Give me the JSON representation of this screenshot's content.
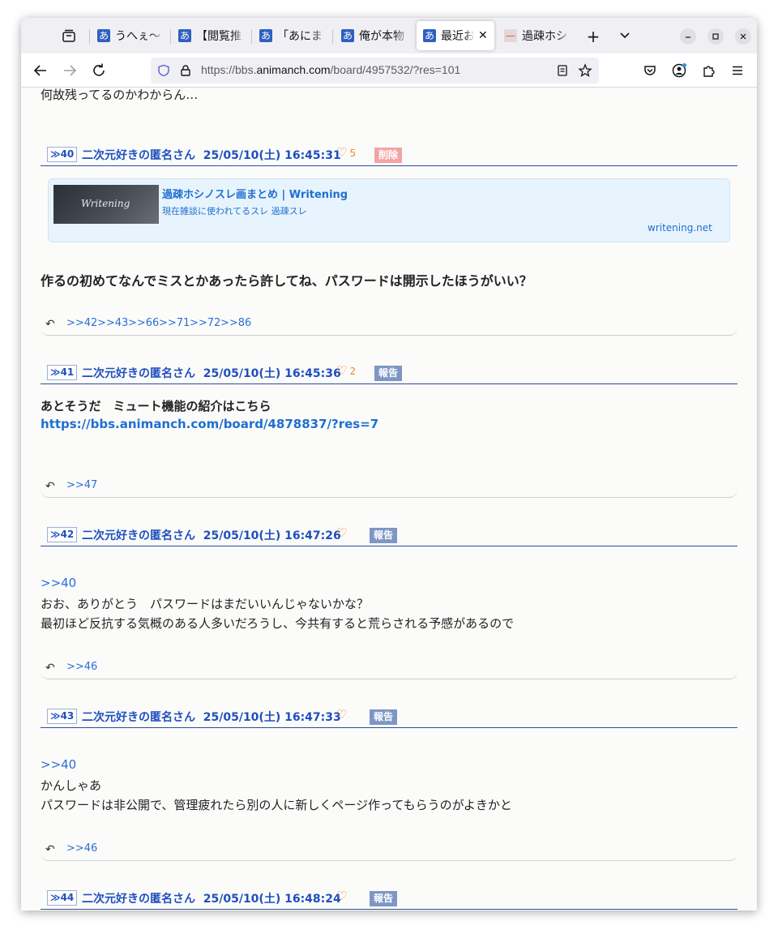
{
  "browser": {
    "tabs": [
      {
        "favicon": "あ",
        "title": "うへぇ〜"
      },
      {
        "favicon": "あ",
        "title": "【閲覧推"
      },
      {
        "favicon": "あ",
        "title": "「あにま"
      },
      {
        "favicon": "あ",
        "title": "俺が本物"
      },
      {
        "favicon": "あ",
        "title": "最近お"
      },
      {
        "favicon": "—",
        "title": "過疎ホシ"
      }
    ],
    "close_glyph": "✕",
    "new_tab_glyph": "+",
    "list_glyph": "⌄",
    "url_prefix": "https://bbs.",
    "url_host": "animanch.com",
    "url_path": "/board/4957532/?res=101"
  },
  "page": {
    "top_text": "何故残ってるのかわからん…",
    "posts": [
      {
        "num": "≫40",
        "name": "二次元好きの匿名さん",
        "date": "25/05/10(土) 16:45:31",
        "likes": "5",
        "badge": "削除",
        "card": {
          "thumb_text": "Writening",
          "title": "過疎ホシノスレ画まとめ | Writening",
          "desc": "現在雑談に使われてるスレ 過疎スレ",
          "domain": "writening.net"
        },
        "body": [
          "作るの初めてなんでミスとかあったら許してね、パスワードは開示したほうがいい？"
        ],
        "replies": [
          ">>42",
          ">>43",
          ">>66",
          ">>71",
          ">>72",
          ">>86"
        ]
      },
      {
        "num": "≫41",
        "name": "二次元好きの匿名さん",
        "date": "25/05/10(土) 16:45:36",
        "likes": "2",
        "badge": "報告",
        "body": [
          "あとそうだ　ミュート機能の紹介はこちら"
        ],
        "link": "https://bbs.animanch.com/board/4878837/?res=7",
        "replies": [
          ">>47"
        ]
      },
      {
        "num": "≫42",
        "name": "二次元好きの匿名さん",
        "date": "25/05/10(土) 16:47:26",
        "likes": "",
        "badge": "報告",
        "anchor": ">>40",
        "body": [
          "おお、ありがとう　パスワードはまだいいんじゃないかな？",
          "最初ほど反抗する気概のある人多いだろうし、今共有すると荒らされる予感があるので"
        ],
        "replies": [
          ">>46"
        ]
      },
      {
        "num": "≫43",
        "name": "二次元好きの匿名さん",
        "date": "25/05/10(土) 16:47:33",
        "likes": "",
        "badge": "報告",
        "anchor": ">>40",
        "body": [
          "かんしゃあ",
          "パスワードは非公開で、管理疲れたら別の人に新しくページ作ってもらうのがよきかと"
        ],
        "replies": [
          ">>46"
        ]
      },
      {
        "num": "≫44",
        "name": "二次元好きの匿名さん",
        "date": "25/05/10(土) 16:48:24",
        "likes": "",
        "badge": "報告"
      }
    ]
  }
}
